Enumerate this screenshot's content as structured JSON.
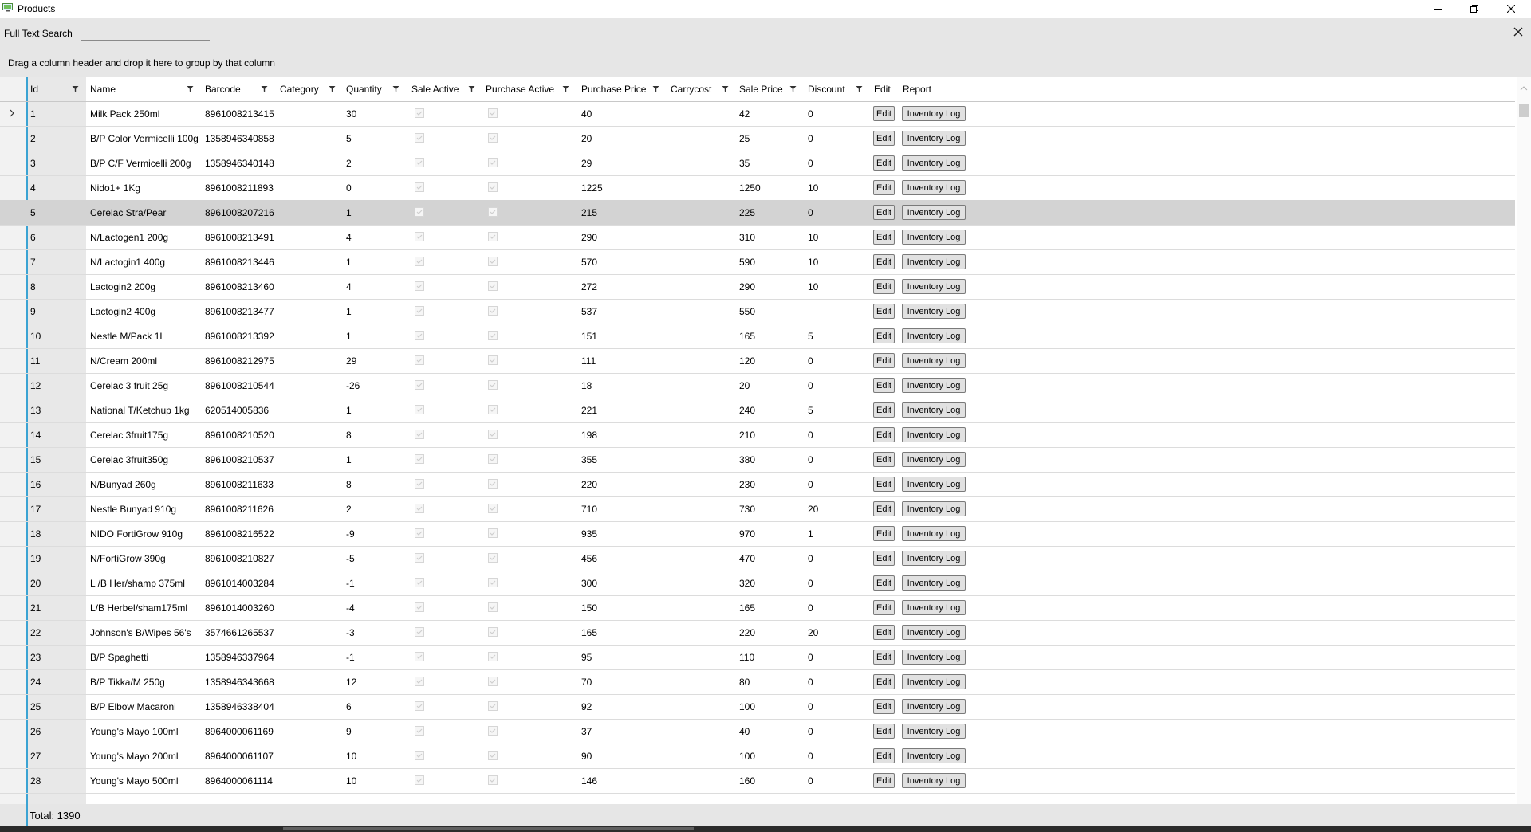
{
  "window": {
    "title": "Products",
    "icon": "app-window-icon"
  },
  "search": {
    "label": "Full Text Search",
    "value": "",
    "placeholder": ""
  },
  "group_panel": {
    "hint": "Drag a column header and drop it here to group by that column"
  },
  "columns": [
    {
      "label": "Id",
      "filter": true
    },
    {
      "label": "Name",
      "filter": true
    },
    {
      "label": "Barcode",
      "filter": true
    },
    {
      "label": "Category",
      "filter": true
    },
    {
      "label": "Quantity",
      "filter": true
    },
    {
      "label": "Sale Active",
      "filter": true
    },
    {
      "label": "Purchase Active",
      "filter": true
    },
    {
      "label": "Purchase Price",
      "filter": true
    },
    {
      "label": "Carrycost",
      "filter": true
    },
    {
      "label": "Sale Price",
      "filter": true
    },
    {
      "label": "Discount",
      "filter": true
    },
    {
      "label": "Edit",
      "filter": false
    },
    {
      "label": "Report",
      "filter": false
    }
  ],
  "buttons": {
    "edit": "Edit",
    "report": "Inventory Log"
  },
  "current_row": 0,
  "selected_row": 4,
  "rows": [
    {
      "id": "1",
      "name": "Milk Pack 250ml",
      "barcode": "8961008213415",
      "category": "",
      "quantity": "30",
      "purchase_price": "40",
      "carrycost": "",
      "sale_price": "42",
      "discount": "0"
    },
    {
      "id": "2",
      "name": "B/P Color Vermicelli 100g",
      "barcode": "1358946340858",
      "category": "",
      "quantity": "5",
      "purchase_price": "20",
      "carrycost": "",
      "sale_price": "25",
      "discount": "0"
    },
    {
      "id": "3",
      "name": "B/P C/F Vermicelli 200g",
      "barcode": "1358946340148",
      "category": "",
      "quantity": "2",
      "purchase_price": "29",
      "carrycost": "",
      "sale_price": "35",
      "discount": "0"
    },
    {
      "id": "4",
      "name": "Nido1+ 1Kg",
      "barcode": "8961008211893",
      "category": "",
      "quantity": "0",
      "purchase_price": "1225",
      "carrycost": "",
      "sale_price": "1250",
      "discount": "10"
    },
    {
      "id": "5",
      "name": "Cerelac Stra/Pear",
      "barcode": "8961008207216",
      "category": "",
      "quantity": "1",
      "purchase_price": "215",
      "carrycost": "",
      "sale_price": "225",
      "discount": "0"
    },
    {
      "id": "6",
      "name": "N/Lactogen1 200g",
      "barcode": "8961008213491",
      "category": "",
      "quantity": "4",
      "purchase_price": "290",
      "carrycost": "",
      "sale_price": "310",
      "discount": "10"
    },
    {
      "id": "7",
      "name": "N/Lactogin1 400g",
      "barcode": "8961008213446",
      "category": "",
      "quantity": "1",
      "purchase_price": "570",
      "carrycost": "",
      "sale_price": "590",
      "discount": "10"
    },
    {
      "id": "8",
      "name": "Lactogin2 200g",
      "barcode": "8961008213460",
      "category": "",
      "quantity": "4",
      "purchase_price": "272",
      "carrycost": "",
      "sale_price": "290",
      "discount": "10"
    },
    {
      "id": "9",
      "name": "Lactogin2 400g",
      "barcode": "8961008213477",
      "category": "",
      "quantity": "1",
      "purchase_price": "537",
      "carrycost": "",
      "sale_price": "550",
      "discount": ""
    },
    {
      "id": "10",
      "name": "Nestle M/Pack 1L",
      "barcode": "8961008213392",
      "category": "",
      "quantity": "1",
      "purchase_price": "151",
      "carrycost": "",
      "sale_price": "165",
      "discount": "5"
    },
    {
      "id": "11",
      "name": "N/Cream 200ml",
      "barcode": "8961008212975",
      "category": "",
      "quantity": "29",
      "purchase_price": "111",
      "carrycost": "",
      "sale_price": "120",
      "discount": "0"
    },
    {
      "id": "12",
      "name": "Cerelac 3 fruit 25g",
      "barcode": "8961008210544",
      "category": "",
      "quantity": "-26",
      "purchase_price": "18",
      "carrycost": "",
      "sale_price": "20",
      "discount": "0"
    },
    {
      "id": "13",
      "name": "National T/Ketchup 1kg",
      "barcode": "620514005836",
      "category": "",
      "quantity": "1",
      "purchase_price": "221",
      "carrycost": "",
      "sale_price": "240",
      "discount": "5"
    },
    {
      "id": "14",
      "name": "Cerelac 3fruit175g",
      "barcode": "8961008210520",
      "category": "",
      "quantity": "8",
      "purchase_price": "198",
      "carrycost": "",
      "sale_price": "210",
      "discount": "0"
    },
    {
      "id": "15",
      "name": "Cerelac 3fruit350g",
      "barcode": "8961008210537",
      "category": "",
      "quantity": "1",
      "purchase_price": "355",
      "carrycost": "",
      "sale_price": "380",
      "discount": "0"
    },
    {
      "id": "16",
      "name": "N/Bunyad 260g",
      "barcode": "8961008211633",
      "category": "",
      "quantity": "8",
      "purchase_price": "220",
      "carrycost": "",
      "sale_price": "230",
      "discount": "0"
    },
    {
      "id": "17",
      "name": "Nestle Bunyad 910g",
      "barcode": "8961008211626",
      "category": "",
      "quantity": "2",
      "purchase_price": "710",
      "carrycost": "",
      "sale_price": "730",
      "discount": "20"
    },
    {
      "id": "18",
      "name": "NIDO FortiGrow 910g",
      "barcode": "8961008216522",
      "category": "",
      "quantity": "-9",
      "purchase_price": "935",
      "carrycost": "",
      "sale_price": "970",
      "discount": "1"
    },
    {
      "id": "19",
      "name": "N/FortiGrow 390g",
      "barcode": "8961008210827",
      "category": "",
      "quantity": "-5",
      "purchase_price": "456",
      "carrycost": "",
      "sale_price": "470",
      "discount": "0"
    },
    {
      "id": "20",
      "name": "L /B Her/shamp 375ml",
      "barcode": "8961014003284",
      "category": "",
      "quantity": "-1",
      "purchase_price": "300",
      "carrycost": "",
      "sale_price": "320",
      "discount": "0"
    },
    {
      "id": "21",
      "name": "L/B Herbel/sham175ml",
      "barcode": "8961014003260",
      "category": "",
      "quantity": "-4",
      "purchase_price": "150",
      "carrycost": "",
      "sale_price": "165",
      "discount": "0"
    },
    {
      "id": "22",
      "name": "Johnson's B/Wipes 56's",
      "barcode": "3574661265537",
      "category": "",
      "quantity": "-3",
      "purchase_price": "165",
      "carrycost": "",
      "sale_price": "220",
      "discount": "20"
    },
    {
      "id": "23",
      "name": "B/P Spaghetti",
      "barcode": "1358946337964",
      "category": "",
      "quantity": "-1",
      "purchase_price": "95",
      "carrycost": "",
      "sale_price": "110",
      "discount": "0"
    },
    {
      "id": "24",
      "name": "B/P Tikka/M 250g",
      "barcode": "1358946343668",
      "category": "",
      "quantity": "12",
      "purchase_price": "70",
      "carrycost": "",
      "sale_price": "80",
      "discount": "0"
    },
    {
      "id": "25",
      "name": "B/P Elbow Macaroni",
      "barcode": "1358946338404",
      "category": "",
      "quantity": "6",
      "purchase_price": "92",
      "carrycost": "",
      "sale_price": "100",
      "discount": "0"
    },
    {
      "id": "26",
      "name": "Young's Mayo 100ml",
      "barcode": "8964000061169",
      "category": "",
      "quantity": "9",
      "purchase_price": "37",
      "carrycost": "",
      "sale_price": "40",
      "discount": "0"
    },
    {
      "id": "27",
      "name": "Young's Mayo 200ml",
      "barcode": "8964000061107",
      "category": "",
      "quantity": "10",
      "purchase_price": "90",
      "carrycost": "",
      "sale_price": "100",
      "discount": "0"
    },
    {
      "id": "28",
      "name": "Young's Mayo 500ml",
      "barcode": "8964000061114",
      "category": "",
      "quantity": "10",
      "purchase_price": "146",
      "carrycost": "",
      "sale_price": "160",
      "discount": "0"
    }
  ],
  "footer": {
    "total_label": "Total: 1390"
  },
  "colors": {
    "accent": "#3ba3d3",
    "selected_row": "#d3d3d3",
    "panel": "#e6e6e6"
  }
}
